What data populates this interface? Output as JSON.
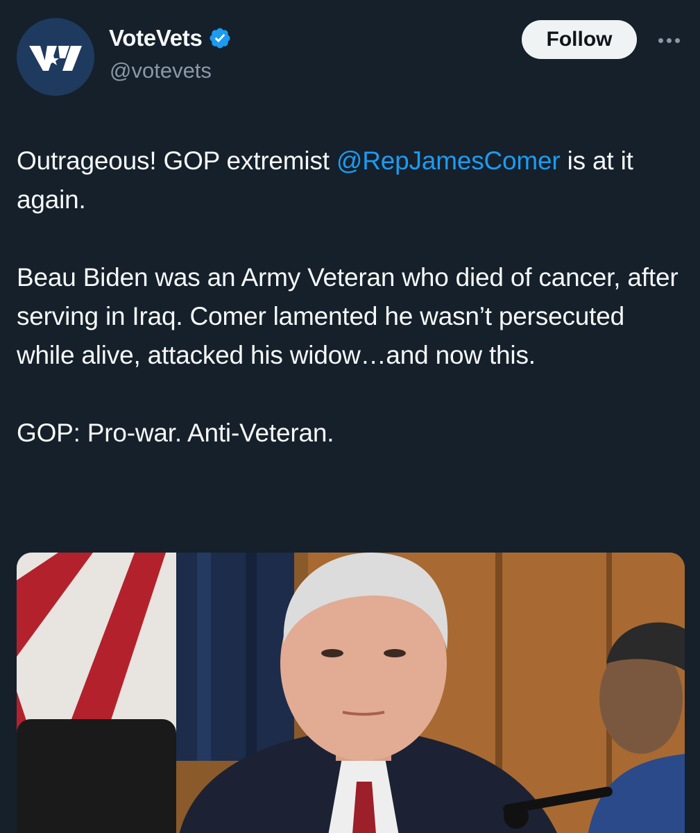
{
  "author": {
    "display_name": "VoteVets",
    "handle": "@votevets",
    "verified": true,
    "avatar_logo": "VV"
  },
  "actions": {
    "follow_label": "Follow",
    "more_icon": "more-horizontal-icon"
  },
  "tweet": {
    "line1_pre": "Outrageous! GOP extremist ",
    "mention": "@RepJamesComer",
    "line1_post": " is at it again.",
    "paragraph2": "Beau Biden was an Army Veteran who died of cancer, after serving in Iraq. Comer lamented he wasn’t persecuted while alive, attacked his widow…and now this.",
    "paragraph3": "GOP: Pro-war. Anti-Veteran."
  },
  "media": {
    "kind": "photo"
  },
  "colors": {
    "background": "#15202b",
    "text": "#f7f9f9",
    "muted": "#8b98a5",
    "link": "#1d9bf0",
    "verified": "#1d9bf0",
    "follow_bg": "#eff3f4"
  }
}
